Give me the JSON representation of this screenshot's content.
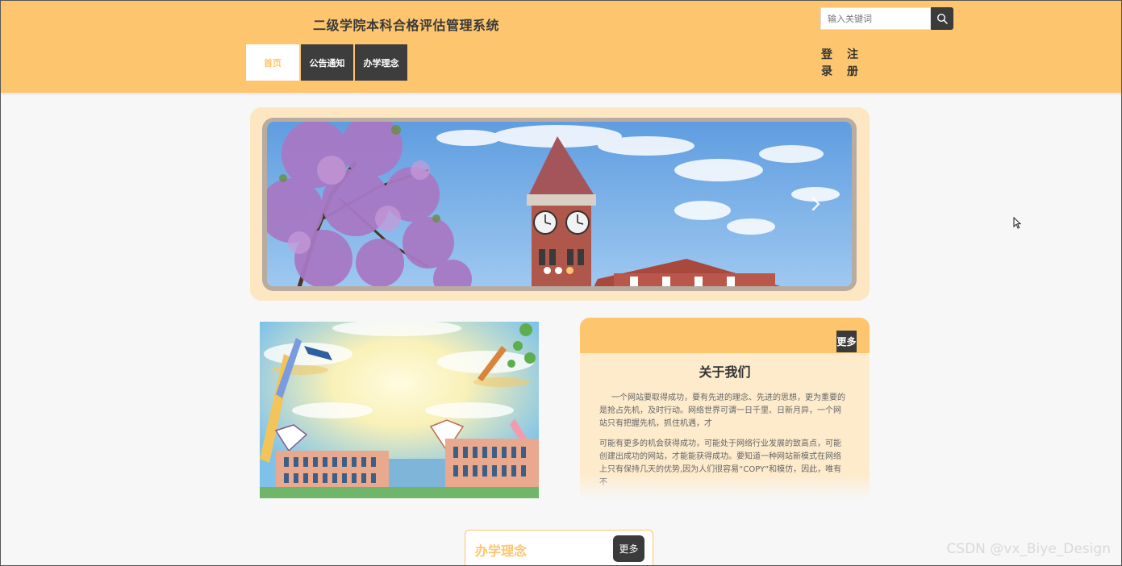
{
  "header": {
    "site_title": "二级学院本科合格评估管理系统",
    "search_placeholder": "输入关键词",
    "nav": [
      {
        "label": "首页",
        "active": true
      },
      {
        "label": "公告通知",
        "active": false
      },
      {
        "label": "办学理念",
        "active": false
      }
    ],
    "login_label": "登录",
    "login_chars": [
      "登",
      "录"
    ],
    "register_label": "注册",
    "register_chars": [
      "注",
      "册"
    ]
  },
  "carousel": {
    "slide_count": 3,
    "active_index": 2
  },
  "about": {
    "more_label": "更多",
    "title": "关于我们",
    "paragraphs": [
      "一个网站要取得成功，要有先进的理念、先进的思想，更为重要的是抢占先机，及时行动。网络世界可谓一日千里、日新月异，一个网站只有把握先机，抓住机遇，才",
      "可能有更多的机会获得成功，可能处于网络行业发展的致高点，可能创建出成功的网站，才能能获得成功。要知道一种网站新模式在网络上只有保持几天的优势,因为人们很容易“COPY”和模仿，因此，唯有不"
    ]
  },
  "philosophy": {
    "title": "办学理念",
    "more_label": "更多"
  },
  "watermark": "CSDN @vx_Biye_Design",
  "colors": {
    "accent": "#fdc66e",
    "dark": "#3b3b3b",
    "panel": "#fdebcc",
    "background": "#f7f7f7"
  }
}
